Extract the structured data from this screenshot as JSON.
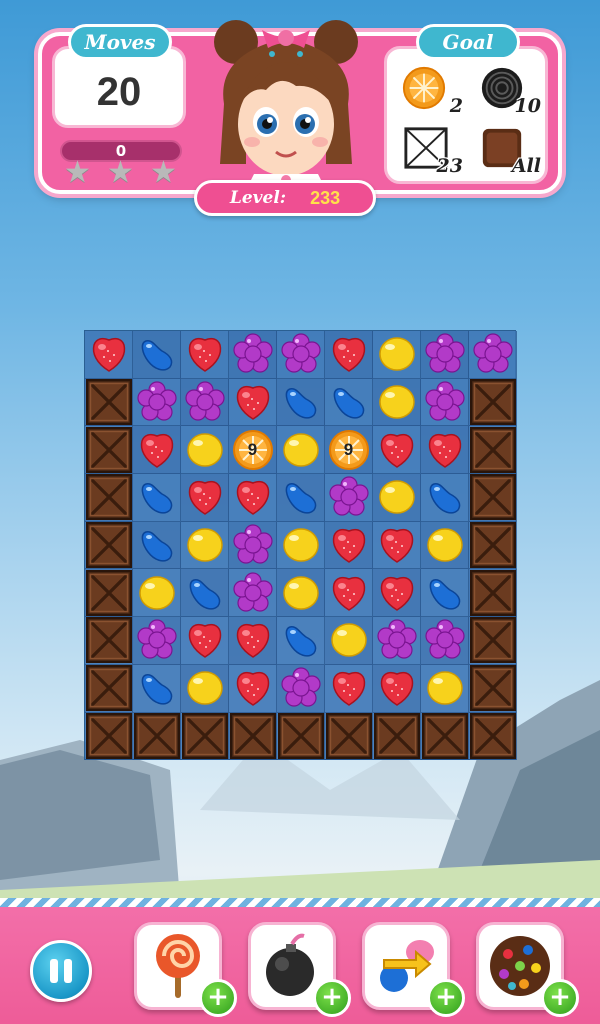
{
  "header": {
    "moves_label": "Moves",
    "moves_value": "20",
    "score_value": "0",
    "stars_earned": 0,
    "stars_total": 3,
    "level_label": "Level:",
    "level_value": "233",
    "goal_label": "Goal",
    "goals": [
      {
        "icon": "orange-slice-icon",
        "count": "2"
      },
      {
        "icon": "licorice-swirl-icon",
        "count": "10"
      },
      {
        "icon": "cracked-tile-icon",
        "count": "23"
      },
      {
        "icon": "chocolate-block-icon",
        "count": "All"
      }
    ]
  },
  "board": {
    "rows": [
      [
        "strawberry",
        "bean",
        "strawberry",
        "flower",
        "flower",
        "strawberry",
        "lemon",
        "flower",
        "flower"
      ],
      [
        "crate",
        "flower",
        "flower",
        "strawberry",
        "bean",
        "bean",
        "lemon",
        "flower",
        "crate"
      ],
      [
        "crate",
        "strawberry",
        "lemon",
        "orange",
        "lemon",
        "orange",
        "strawberry",
        "strawberry",
        "crate"
      ],
      [
        "crate",
        "bean",
        "strawberry",
        "strawberry",
        "bean",
        "flower",
        "lemon",
        "bean",
        "crate"
      ],
      [
        "crate",
        "bean",
        "lemon",
        "flower",
        "lemon",
        "strawberry",
        "strawberry",
        "lemon",
        "crate"
      ],
      [
        "crate",
        "lemon",
        "bean",
        "flower",
        "lemon",
        "strawberry",
        "strawberry",
        "bean",
        "crate"
      ],
      [
        "crate",
        "flower",
        "strawberry",
        "strawberry",
        "bean",
        "lemon",
        "flower",
        "flower",
        "crate"
      ],
      [
        "crate",
        "bean",
        "lemon",
        "strawberry",
        "flower",
        "strawberry",
        "strawberry",
        "lemon",
        "crate"
      ],
      [
        "crate",
        "crate",
        "crate",
        "crate",
        "crate",
        "crate",
        "crate",
        "crate",
        "crate"
      ]
    ],
    "orange_counters": [
      "9",
      "9"
    ]
  },
  "boosters": [
    {
      "icon": "lollipop-icon",
      "plus": "+"
    },
    {
      "icon": "bomb-icon",
      "plus": "+"
    },
    {
      "icon": "swap-arrows-icon",
      "plus": "+"
    },
    {
      "icon": "color-bomb-icon",
      "plus": "+"
    }
  ],
  "colors": {
    "header_pink": "#f262a3",
    "pill_teal": "#3fb7cf",
    "level_yellow": "#ffe14a",
    "candy_red": "#e8303f",
    "candy_blue": "#1d6fd6",
    "candy_purple": "#b23ac8",
    "candy_yellow": "#f7d21c"
  }
}
